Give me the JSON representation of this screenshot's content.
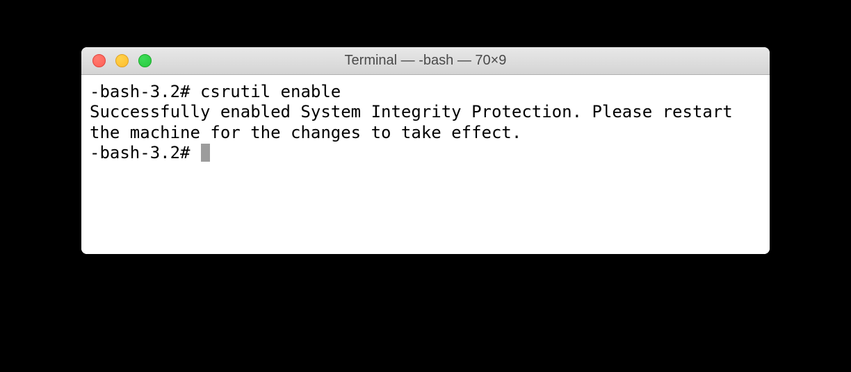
{
  "window": {
    "title": "Terminal — -bash — 70×9"
  },
  "terminal": {
    "lines": [
      {
        "prompt": "-bash-3.2# ",
        "command": "csrutil enable"
      }
    ],
    "output": "Successfully enabled System Integrity Protection. Please restart the machine for the changes to take effect.",
    "prompt2": "-bash-3.2# "
  }
}
